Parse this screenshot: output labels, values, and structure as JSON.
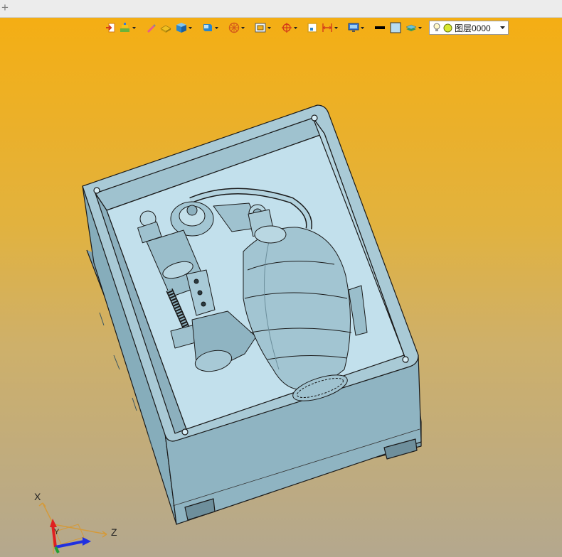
{
  "tabs": {
    "new_tab_symbol": "+"
  },
  "toolbar": {
    "buttons": [
      {
        "name": "import-icon",
        "has_dropdown": false
      },
      {
        "name": "layer-paint-icon",
        "has_dropdown": true
      },
      {
        "name": "pen-icon",
        "has_dropdown": false
      },
      {
        "name": "sheet-shape-icon",
        "has_dropdown": false
      },
      {
        "name": "solid-box-icon",
        "has_dropdown": true
      },
      {
        "name": "display-mode-icon",
        "has_dropdown": true
      },
      {
        "name": "wheel-icon",
        "has_dropdown": true
      },
      {
        "name": "fit-view-icon",
        "has_dropdown": true
      },
      {
        "name": "target-icon",
        "has_dropdown": true
      },
      {
        "name": "frame-icon",
        "has_dropdown": false
      },
      {
        "name": "dimension-icon",
        "has_dropdown": true
      },
      {
        "name": "monitor-icon",
        "has_dropdown": true
      },
      {
        "name": "line-color-icon",
        "has_dropdown": false
      },
      {
        "name": "fill-color-icon",
        "has_dropdown": false
      },
      {
        "name": "layers-icon",
        "has_dropdown": true
      }
    ],
    "colors": {
      "line_color": "#000000",
      "fill_color": "#b8dcef"
    },
    "layer_combo": {
      "value": "图层0000",
      "bulb_icon": "lightbulb-icon",
      "dot_color": "#d8e830"
    }
  },
  "viewport": {
    "background_top": "#f6ae10",
    "background_bottom": "#b4a88e",
    "model_color": "#93b8c6",
    "model_inner_color": "#c5e2ee"
  },
  "triad": {
    "x_label": "X",
    "y_label": "Y",
    "z_label": "Z"
  }
}
